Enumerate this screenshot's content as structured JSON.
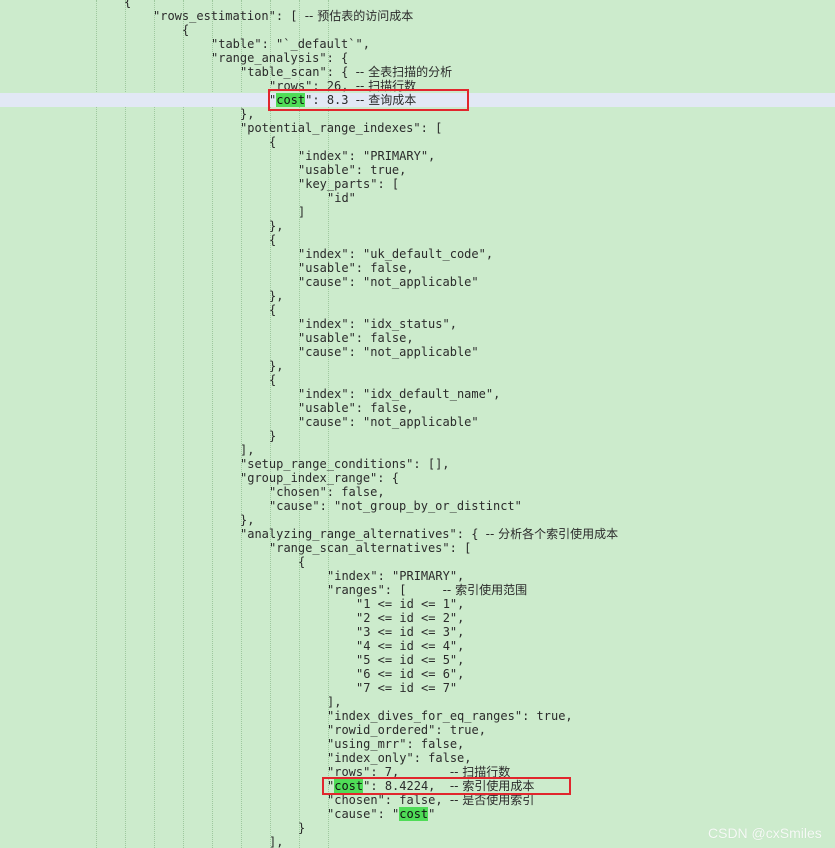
{
  "editor": {
    "colors": {
      "background": "#ccebcc",
      "selection_line": "#e2e8f5",
      "highlight": "#4fdc57",
      "red_box": "#e1262d"
    },
    "lines": [
      {
        "text": "{"
      },
      {
        "parts": [
          "\"rows_estimation\": [ ",
          "-- 预估表的访问成本"
        ]
      },
      {
        "text": "{"
      },
      {
        "text": "\"table\": \"`_default`\","
      },
      {
        "text": "\"range_analysis\": {"
      },
      {
        "parts": [
          "\"table_scan\": { ",
          "-- 全表扫描的分析"
        ]
      },
      {
        "parts": [
          "\"rows\": 26, ",
          "-- 扫描行数"
        ]
      },
      {
        "parts": [
          "\"",
          "cost",
          "\": 8.3 ",
          "-- 查询成本"
        ]
      },
      {
        "text": "},"
      },
      {
        "text": "\"potential_range_indexes\": ["
      },
      {
        "text": "{"
      },
      {
        "text": "\"index\": \"PRIMARY\","
      },
      {
        "text": "\"usable\": true,"
      },
      {
        "text": "\"key_parts\": ["
      },
      {
        "text": "\"id\""
      },
      {
        "text": "]"
      },
      {
        "text": "},"
      },
      {
        "text": "{"
      },
      {
        "text": "\"index\": \"uk_default_code\","
      },
      {
        "text": "\"usable\": false,"
      },
      {
        "text": "\"cause\": \"not_applicable\""
      },
      {
        "text": "},"
      },
      {
        "text": "{"
      },
      {
        "text": "\"index\": \"idx_status\","
      },
      {
        "text": "\"usable\": false,"
      },
      {
        "text": "\"cause\": \"not_applicable\""
      },
      {
        "text": "},"
      },
      {
        "text": "{"
      },
      {
        "text": "\"index\": \"idx_default_name\","
      },
      {
        "text": "\"usable\": false,"
      },
      {
        "text": "\"cause\": \"not_applicable\""
      },
      {
        "text": "}"
      },
      {
        "text": "],"
      },
      {
        "text": "\"setup_range_conditions\": [],"
      },
      {
        "text": "\"group_index_range\": {"
      },
      {
        "text": "\"chosen\": false,"
      },
      {
        "text": "\"cause\": \"not_group_by_or_distinct\""
      },
      {
        "text": "},"
      },
      {
        "parts": [
          "\"analyzing_range_alternatives\": { ",
          "-- 分析各个索引使用成本"
        ]
      },
      {
        "text": "\"range_scan_alternatives\": ["
      },
      {
        "text": "{"
      },
      {
        "text": "\"index\": \"PRIMARY\","
      },
      {
        "parts": [
          "\"ranges\": [     ",
          "-- 索引使用范围"
        ]
      },
      {
        "text": "\"1 <= id <= 1\","
      },
      {
        "text": "\"2 <= id <= 2\","
      },
      {
        "text": "\"3 <= id <= 3\","
      },
      {
        "text": "\"4 <= id <= 4\","
      },
      {
        "text": "\"5 <= id <= 5\","
      },
      {
        "text": "\"6 <= id <= 6\","
      },
      {
        "text": "\"7 <= id <= 7\""
      },
      {
        "text": "],"
      },
      {
        "text": "\"index_dives_for_eq_ranges\": true,"
      },
      {
        "text": "\"rowid_ordered\": true,"
      },
      {
        "text": "\"using_mrr\": false,"
      },
      {
        "text": "\"index_only\": false,"
      },
      {
        "parts": [
          "\"rows\": 7,       ",
          "-- 扫描行数"
        ]
      },
      {
        "parts": [
          "\"",
          "cost",
          "\": 8.4224,  ",
          "-- 索引使用成本"
        ]
      },
      {
        "parts": [
          "\"chosen\": false, ",
          "-- 是否使用索引"
        ]
      },
      {
        "parts": [
          "\"cause\": \"",
          "cost",
          "\""
        ]
      },
      {
        "text": "}"
      },
      {
        "text": "],"
      }
    ]
  },
  "watermark": "CSDN @cxSmiles"
}
